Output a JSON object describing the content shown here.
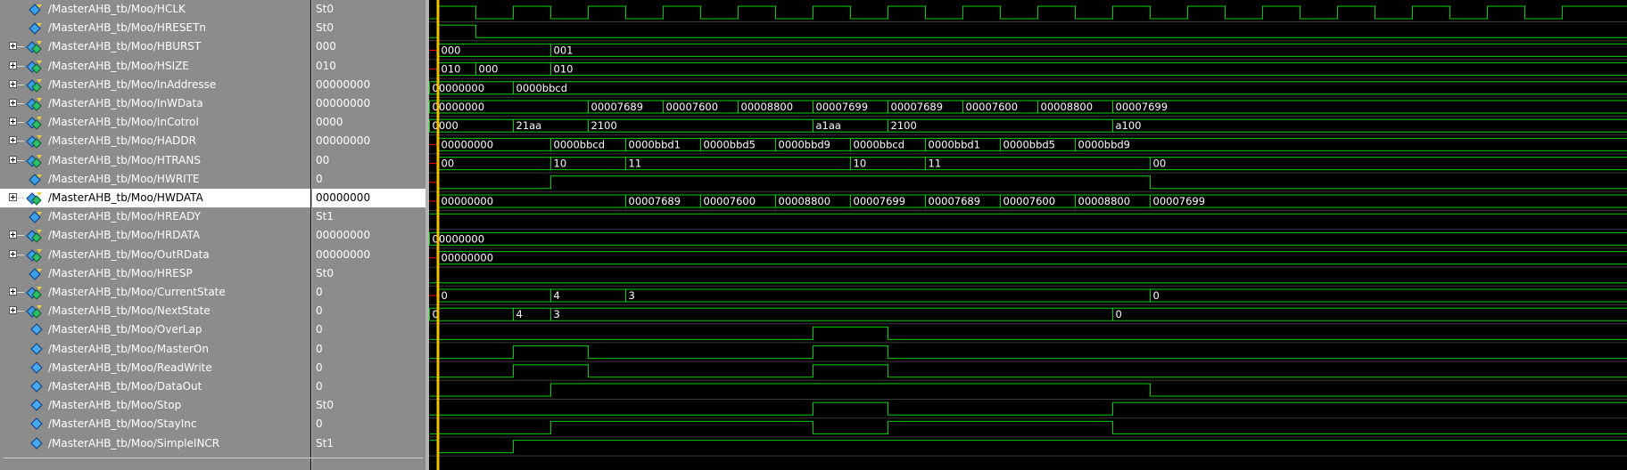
{
  "wave_colors": {
    "background": "#000000",
    "signal": "#00d000",
    "cursor": "#f0c000",
    "row_divider": "#3a3a3a",
    "undefined": "#ff0000",
    "label": "#ffffff"
  },
  "signals": [
    {
      "name": "/MasterAHB_tb/Moo/HCLK",
      "value": "St0",
      "expandable": false,
      "icon": "signal-bit-icon",
      "type": "bit",
      "changes": [
        [
          0,
          0
        ],
        [
          1,
          1
        ],
        [
          5,
          0
        ],
        [
          9,
          1
        ],
        [
          13,
          0
        ],
        [
          17,
          1
        ],
        [
          21,
          0
        ],
        [
          25,
          1
        ],
        [
          29,
          0
        ],
        [
          33,
          1
        ],
        [
          37,
          0
        ],
        [
          41,
          1
        ],
        [
          45,
          0
        ],
        [
          49,
          1
        ],
        [
          53,
          0
        ],
        [
          57,
          1
        ],
        [
          61,
          0
        ],
        [
          65,
          1
        ],
        [
          69,
          0
        ],
        [
          73,
          1
        ],
        [
          77,
          0
        ],
        [
          81,
          1
        ],
        [
          85,
          0
        ],
        [
          89,
          1
        ],
        [
          93,
          0
        ],
        [
          97,
          1
        ],
        [
          101,
          0
        ],
        [
          105,
          1
        ],
        [
          109,
          0
        ],
        [
          113,
          1
        ],
        [
          117,
          0
        ],
        [
          121,
          1
        ]
      ]
    },
    {
      "name": "/MasterAHB_tb/Moo/HRESETn",
      "value": "St0",
      "expandable": false,
      "icon": "signal-bit-icon",
      "type": "bit",
      "changes": [
        [
          0,
          0
        ],
        [
          1,
          1
        ],
        [
          5,
          0
        ]
      ]
    },
    {
      "name": "/MasterAHB_tb/Moo/HBURST",
      "value": "000",
      "expandable": true,
      "icon": "signal-bus-icon",
      "type": "bus",
      "changes": [
        [
          1,
          "000"
        ],
        [
          13,
          "001"
        ]
      ]
    },
    {
      "name": "/MasterAHB_tb/Moo/HSIZE",
      "value": "010",
      "expandable": true,
      "icon": "signal-bus-icon",
      "type": "bus",
      "changes": [
        [
          1,
          "010"
        ],
        [
          5,
          "000"
        ],
        [
          13,
          "010"
        ]
      ]
    },
    {
      "name": "/MasterAHB_tb/Moo/InAddresse",
      "value": "00000000",
      "expandable": true,
      "icon": "signal-bus-icon",
      "type": "bus",
      "changes": [
        [
          0,
          "00000000"
        ],
        [
          9,
          "0000bbcd"
        ]
      ]
    },
    {
      "name": "/MasterAHB_tb/Moo/InWData",
      "value": "00000000",
      "expandable": true,
      "icon": "signal-bus-icon",
      "type": "bus",
      "changes": [
        [
          0,
          "00000000"
        ],
        [
          17,
          "00007689"
        ],
        [
          25,
          "00007600"
        ],
        [
          33,
          "00008800"
        ],
        [
          41,
          "00007699"
        ],
        [
          49,
          "00007689"
        ],
        [
          57,
          "00007600"
        ],
        [
          65,
          "00008800"
        ],
        [
          73,
          "00007699"
        ]
      ]
    },
    {
      "name": "/MasterAHB_tb/Moo/InCotrol",
      "value": "0000",
      "expandable": true,
      "icon": "signal-bus-icon",
      "type": "bus",
      "changes": [
        [
          0,
          "0000"
        ],
        [
          9,
          "21aa"
        ],
        [
          17,
          "2100"
        ],
        [
          41,
          "a1aa"
        ],
        [
          49,
          "2100"
        ],
        [
          73,
          "a100"
        ]
      ]
    },
    {
      "name": "/MasterAHB_tb/Moo/HADDR",
      "value": "00000000",
      "expandable": true,
      "icon": "signal-bus-icon",
      "type": "bus",
      "changes": [
        [
          1,
          "00000000"
        ],
        [
          13,
          "0000bbcd"
        ],
        [
          21,
          "0000bbd1"
        ],
        [
          29,
          "0000bbd5"
        ],
        [
          37,
          "0000bbd9"
        ],
        [
          45,
          "0000bbcd"
        ],
        [
          53,
          "0000bbd1"
        ],
        [
          61,
          "0000bbd5"
        ],
        [
          69,
          "0000bbd9"
        ]
      ]
    },
    {
      "name": "/MasterAHB_tb/Moo/HTRANS",
      "value": "00",
      "expandable": true,
      "icon": "signal-bus-icon",
      "type": "bus",
      "changes": [
        [
          1,
          "00"
        ],
        [
          13,
          "10"
        ],
        [
          21,
          "11"
        ],
        [
          45,
          "10"
        ],
        [
          53,
          "11"
        ],
        [
          77,
          "00"
        ]
      ]
    },
    {
      "name": "/MasterAHB_tb/Moo/HWRITE",
      "value": "0",
      "expandable": false,
      "icon": "signal-bit-icon",
      "type": "bit",
      "changes": [
        [
          1,
          0
        ],
        [
          13,
          1
        ],
        [
          77,
          0
        ]
      ]
    },
    {
      "name": "/MasterAHB_tb/Moo/HWDATA",
      "value": "00000000",
      "expandable": true,
      "icon": "signal-bus-icon",
      "type": "bus",
      "selected": true,
      "changes": [
        [
          1,
          "00000000"
        ],
        [
          21,
          "00007689"
        ],
        [
          29,
          "00007600"
        ],
        [
          37,
          "00008800"
        ],
        [
          45,
          "00007699"
        ],
        [
          53,
          "00007689"
        ],
        [
          61,
          "00007600"
        ],
        [
          69,
          "00008800"
        ],
        [
          77,
          "00007699"
        ]
      ]
    },
    {
      "name": "/MasterAHB_tb/Moo/HREADY",
      "value": "St1",
      "expandable": false,
      "icon": "signal-bit-icon",
      "type": "bit",
      "changes": [
        [
          0,
          1
        ]
      ]
    },
    {
      "name": "/MasterAHB_tb/Moo/HRDATA",
      "value": "00000000",
      "expandable": true,
      "icon": "signal-bus-icon",
      "type": "bus",
      "changes": [
        [
          0,
          "00000000"
        ]
      ]
    },
    {
      "name": "/MasterAHB_tb/Moo/OutRData",
      "value": "00000000",
      "expandable": true,
      "icon": "signal-bus-icon",
      "type": "bus",
      "changes": [
        [
          1,
          "00000000"
        ]
      ]
    },
    {
      "name": "/MasterAHB_tb/Moo/HRESP",
      "value": "St0",
      "expandable": false,
      "icon": "signal-bit-icon",
      "type": "bit",
      "changes": [
        [
          0,
          0
        ]
      ]
    },
    {
      "name": "/MasterAHB_tb/Moo/CurrentState",
      "value": "0",
      "expandable": true,
      "icon": "signal-bus-icon",
      "type": "bus",
      "changes": [
        [
          1,
          "0"
        ],
        [
          13,
          "4"
        ],
        [
          21,
          "3"
        ],
        [
          77,
          "0"
        ]
      ]
    },
    {
      "name": "/MasterAHB_tb/Moo/NextState",
      "value": "0",
      "expandable": true,
      "icon": "signal-bus-icon",
      "type": "bus",
      "changes": [
        [
          0,
          "0"
        ],
        [
          9,
          "4"
        ],
        [
          13,
          "3"
        ],
        [
          73,
          "0"
        ]
      ]
    },
    {
      "name": "/MasterAHB_tb/Moo/OverLap",
      "value": "0",
      "expandable": false,
      "icon": "signal-reg-icon",
      "type": "bit",
      "changes": [
        [
          0,
          0
        ],
        [
          41,
          1
        ],
        [
          49,
          0
        ]
      ]
    },
    {
      "name": "/MasterAHB_tb/Moo/MasterOn",
      "value": "0",
      "expandable": false,
      "icon": "signal-reg-icon",
      "type": "bit",
      "changes": [
        [
          0,
          0
        ],
        [
          9,
          1
        ],
        [
          17,
          0
        ],
        [
          41,
          1
        ],
        [
          49,
          0
        ]
      ]
    },
    {
      "name": "/MasterAHB_tb/Moo/ReadWrite",
      "value": "0",
      "expandable": false,
      "icon": "signal-reg-icon",
      "type": "bit",
      "changes": [
        [
          0,
          0
        ],
        [
          9,
          1
        ],
        [
          17,
          0
        ],
        [
          41,
          1
        ],
        [
          49,
          0
        ]
      ]
    },
    {
      "name": "/MasterAHB_tb/Moo/DataOut",
      "value": "0",
      "expandable": false,
      "icon": "signal-reg-icon",
      "type": "bit",
      "changes": [
        [
          0,
          0
        ],
        [
          13,
          1
        ],
        [
          77,
          0
        ]
      ]
    },
    {
      "name": "/MasterAHB_tb/Moo/Stop",
      "value": "St0",
      "expandable": false,
      "icon": "signal-reg-icon",
      "type": "bit",
      "changes": [
        [
          0,
          0
        ],
        [
          41,
          1
        ],
        [
          49,
          0
        ],
        [
          73,
          1
        ]
      ]
    },
    {
      "name": "/MasterAHB_tb/Moo/StayInc",
      "value": "0",
      "expandable": false,
      "icon": "signal-reg-icon",
      "type": "bit",
      "changes": [
        [
          0,
          0
        ],
        [
          13,
          1
        ],
        [
          41,
          0
        ],
        [
          49,
          1
        ],
        [
          73,
          0
        ]
      ]
    },
    {
      "name": "/MasterAHB_tb/Moo/SimpleINCR",
      "value": "St1",
      "expandable": false,
      "icon": "signal-reg-icon",
      "type": "bit",
      "changes": [
        [
          0,
          1
        ],
        [
          1,
          0
        ],
        [
          9,
          1
        ]
      ]
    }
  ],
  "cursor_time": 1,
  "time_span": 128
}
